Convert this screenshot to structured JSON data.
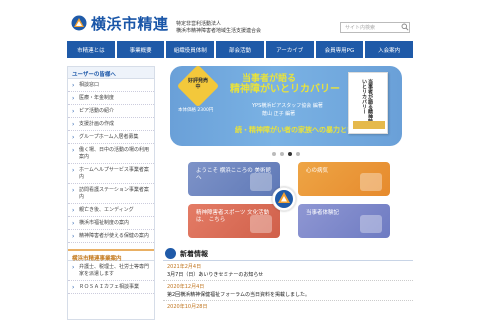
{
  "header": {
    "site_title": "横浜市精連",
    "org_line1": "特定非営利活動法人",
    "org_line2": "横浜市精神障害者地域生活支援連合会",
    "search_placeholder": "サイト内検索"
  },
  "nav": [
    "市精連とは",
    "事業概要",
    "組織役員体制",
    "部会活動",
    "アーカイブ",
    "会員専用PG",
    "入会案内"
  ],
  "sidebar": {
    "heading": "ユーザーの皆様へ",
    "items": [
      "相談窓口",
      "医療・年金制度",
      "ピア活動の紹介",
      "支援計画の作成",
      "グループホーム入居者募集",
      "働く場、日中の活動の場の利用案内",
      "ホームヘルプサービス事業者案内",
      "訪問看護ステーション事業者案内",
      "親亡き後、エンディング",
      "横浜市福祉制度の案内",
      "精神障害者が使える保健の案内"
    ],
    "heading2": "横浜市精連事業案内",
    "items2": [
      "弁護士、税理士、社労士等専門家を派遣します",
      "ＲＯＳＡＩカフェ相談事業"
    ]
  },
  "banner": {
    "badge": "好評発売中",
    "price": "本体価格 2300円",
    "title1": "当事者が語る",
    "title2": "精神障がいとリカバリー",
    "publisher": "YPS横浜ピアスタッフ協会 編著",
    "author": "蔭山 正子 編著",
    "subtitle": "続・精神障がい者の家族への暴力という SOS",
    "cover_title": "当事者が語る精神障がいとリカバリー"
  },
  "tiles": [
    "ようこそ 横浜こころの 美術館へ",
    "心の病気",
    "精神障害者スポーツ 文化活動は、 こちら",
    "当事者体験記"
  ],
  "news": {
    "title": "新着情報",
    "entries": [
      {
        "date": "2021年2月4日",
        "text": "3月7日（日）あいりきセミナーのお知らせ"
      },
      {
        "date": "2020年12月4日",
        "text": "第2回横浜精神保健福祉フォーラムの当日資料を掲載しました。"
      },
      {
        "date": "2020年10月28日",
        "text": ""
      }
    ]
  },
  "slider": {
    "active": 2,
    "count": 4
  },
  "colors": {
    "brand": "#1f5aa8",
    "accent": "#c0741e"
  }
}
